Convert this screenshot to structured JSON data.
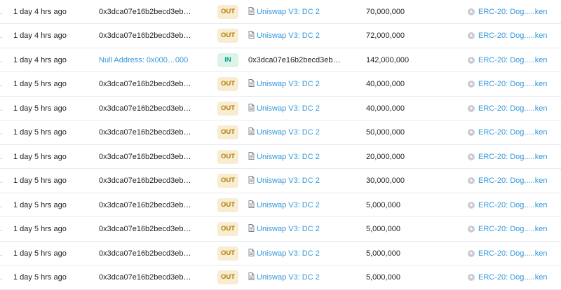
{
  "transactions": [
    {
      "age": "1 day 4 hrs ago",
      "from": "0x3dca07e16b2becd3eb…",
      "direction": "OUT",
      "to": "Uniswap V3: DC 2",
      "quantity": "70,000,000",
      "token": "ERC-20: Dog.....ken"
    },
    {
      "age": "1 day 4 hrs ago",
      "from": "0x3dca07e16b2becd3eb…",
      "direction": "OUT",
      "to": "Uniswap V3: DC 2",
      "quantity": "72,000,000",
      "token": "ERC-20: Dog.....ken"
    },
    {
      "age": "1 day 4 hrs ago",
      "from": "Null Address: 0x000…000",
      "direction": "IN",
      "to": "0x3dca07e16b2becd3eb…",
      "quantity": "142,000,000",
      "token": "ERC-20: Dog.....ken"
    },
    {
      "age": "1 day 5 hrs ago",
      "from": "0x3dca07e16b2becd3eb…",
      "direction": "OUT",
      "to": "Uniswap V3: DC 2",
      "quantity": "40,000,000",
      "token": "ERC-20: Dog.....ken"
    },
    {
      "age": "1 day 5 hrs ago",
      "from": "0x3dca07e16b2becd3eb…",
      "direction": "OUT",
      "to": "Uniswap V3: DC 2",
      "quantity": "40,000,000",
      "token": "ERC-20: Dog.....ken"
    },
    {
      "age": "1 day 5 hrs ago",
      "from": "0x3dca07e16b2becd3eb…",
      "direction": "OUT",
      "to": "Uniswap V3: DC 2",
      "quantity": "50,000,000",
      "token": "ERC-20: Dog.....ken"
    },
    {
      "age": "1 day 5 hrs ago",
      "from": "0x3dca07e16b2becd3eb…",
      "direction": "OUT",
      "to": "Uniswap V3: DC 2",
      "quantity": "20,000,000",
      "token": "ERC-20: Dog.....ken"
    },
    {
      "age": "1 day 5 hrs ago",
      "from": "0x3dca07e16b2becd3eb…",
      "direction": "OUT",
      "to": "Uniswap V3: DC 2",
      "quantity": "30,000,000",
      "token": "ERC-20: Dog.....ken"
    },
    {
      "age": "1 day 5 hrs ago",
      "from": "0x3dca07e16b2becd3eb…",
      "direction": "OUT",
      "to": "Uniswap V3: DC 2",
      "quantity": "5,000,000",
      "token": "ERC-20: Dog.....ken"
    },
    {
      "age": "1 day 5 hrs ago",
      "from": "0x3dca07e16b2becd3eb…",
      "direction": "OUT",
      "to": "Uniswap V3: DC 2",
      "quantity": "5,000,000",
      "token": "ERC-20: Dog.....ken"
    },
    {
      "age": "1 day 5 hrs ago",
      "from": "0x3dca07e16b2becd3eb…",
      "direction": "OUT",
      "to": "Uniswap V3: DC 2",
      "quantity": "5,000,000",
      "token": "ERC-20: Dog.....ken"
    },
    {
      "age": "1 day 5 hrs ago",
      "from": "0x3dca07e16b2becd3eb…",
      "direction": "OUT",
      "to": "Uniswap V3: DC 2",
      "quantity": "5,000,000",
      "token": "ERC-20: Dog.....ken"
    }
  ],
  "colors": {
    "link": "#3498db",
    "out_badge_bg": "#f8ecd3",
    "out_badge_text": "#b47d00",
    "in_badge_bg": "#dcf3ea",
    "in_badge_text": "#00a186",
    "row_divider": "#e7eaf3"
  },
  "icons": {
    "contract": "contract-document-icon",
    "token": "token-logo-icon"
  }
}
